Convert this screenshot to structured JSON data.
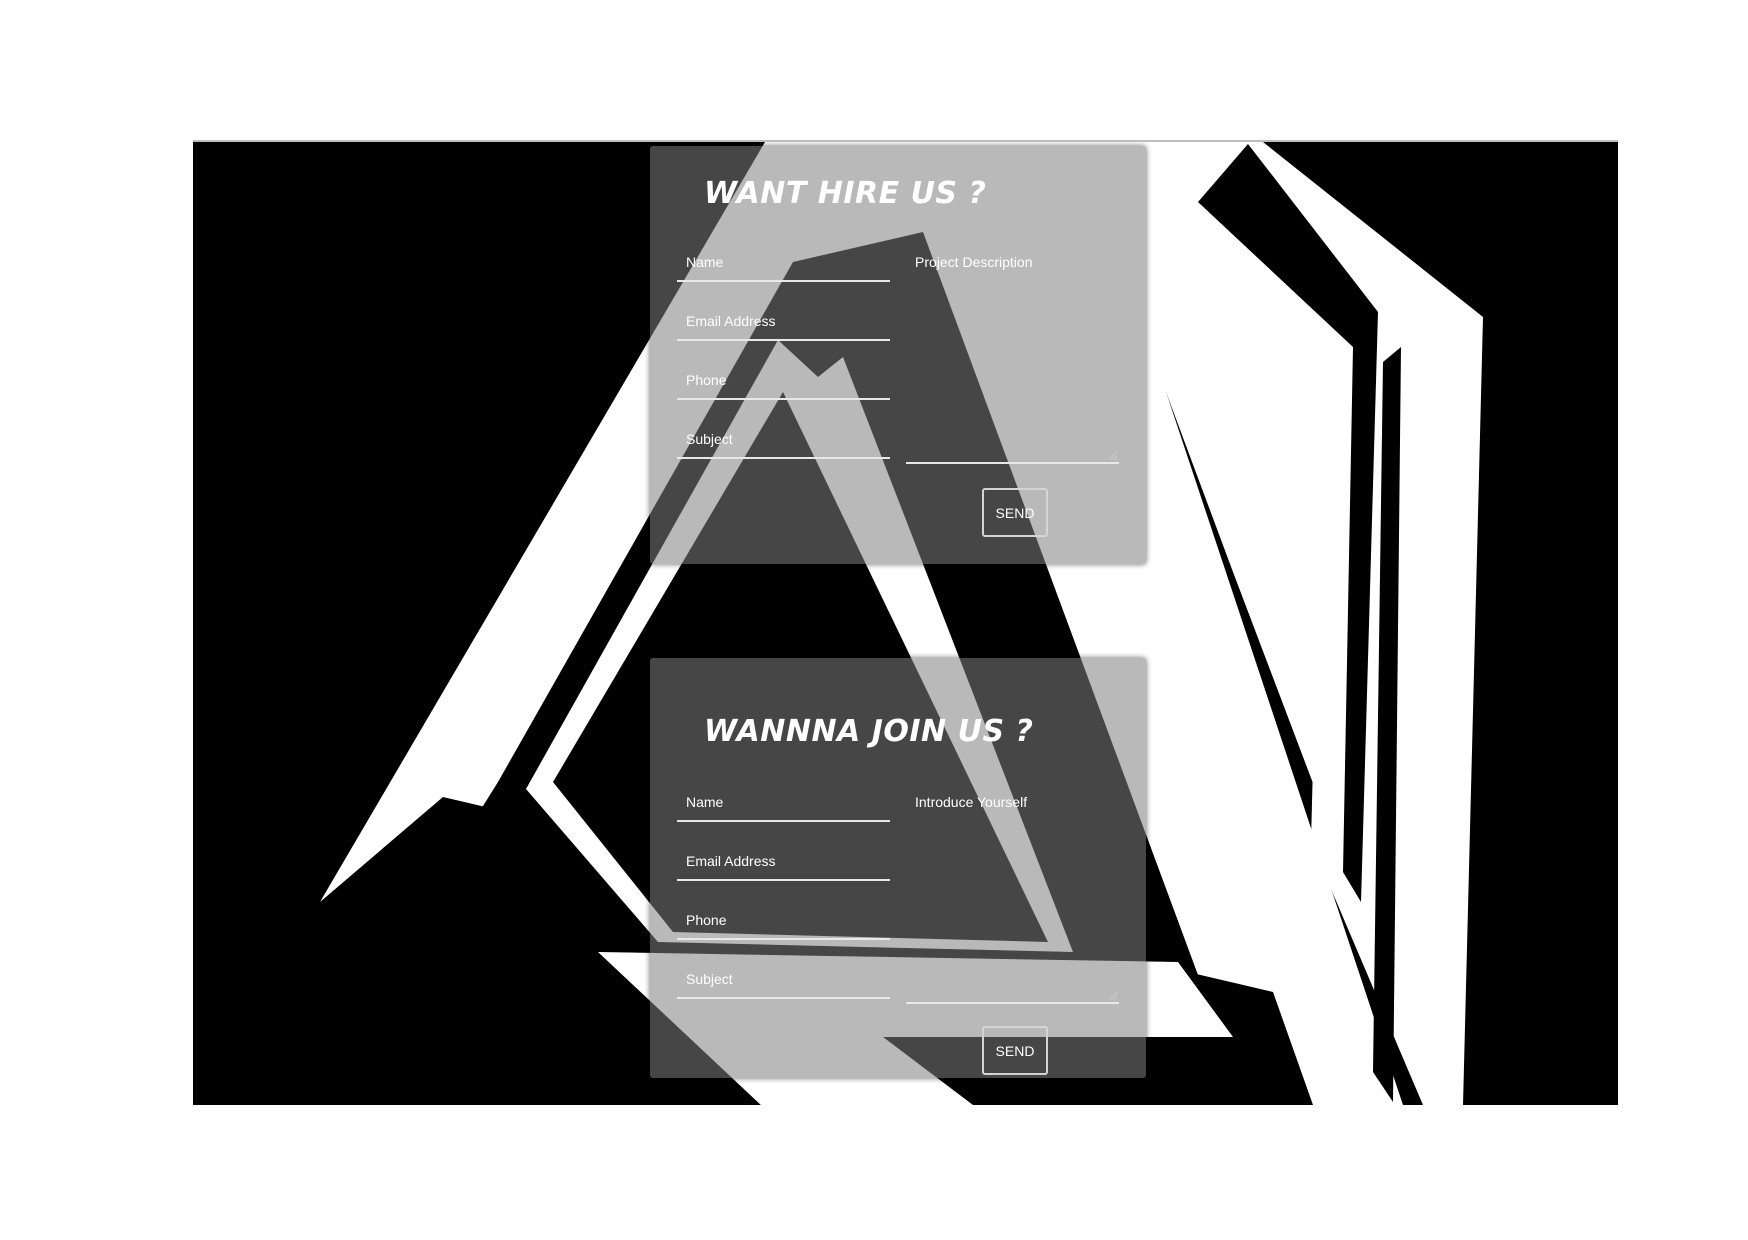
{
  "hire_form": {
    "title": "WANT HIRE US ?",
    "fields": {
      "name": "Name",
      "email": "Email Address",
      "phone": "Phone",
      "subject": "Subject"
    },
    "textarea_label": "Project Description",
    "send_label": "SEND"
  },
  "join_form": {
    "title": "WANNNA JOIN US ?",
    "fields": {
      "name": "Name",
      "email": "Email Address",
      "phone": "Phone",
      "subject": "Subject"
    },
    "textarea_label": "Introduce Yourself",
    "send_label": "SEND"
  },
  "colors": {
    "background": "#000000",
    "logo": "#ffffff",
    "card": "#808080",
    "text": "#ffffff"
  },
  "icons": {
    "background_logo": "abstract-triangle-logo",
    "resize_grip": "resize-grip-icon"
  }
}
